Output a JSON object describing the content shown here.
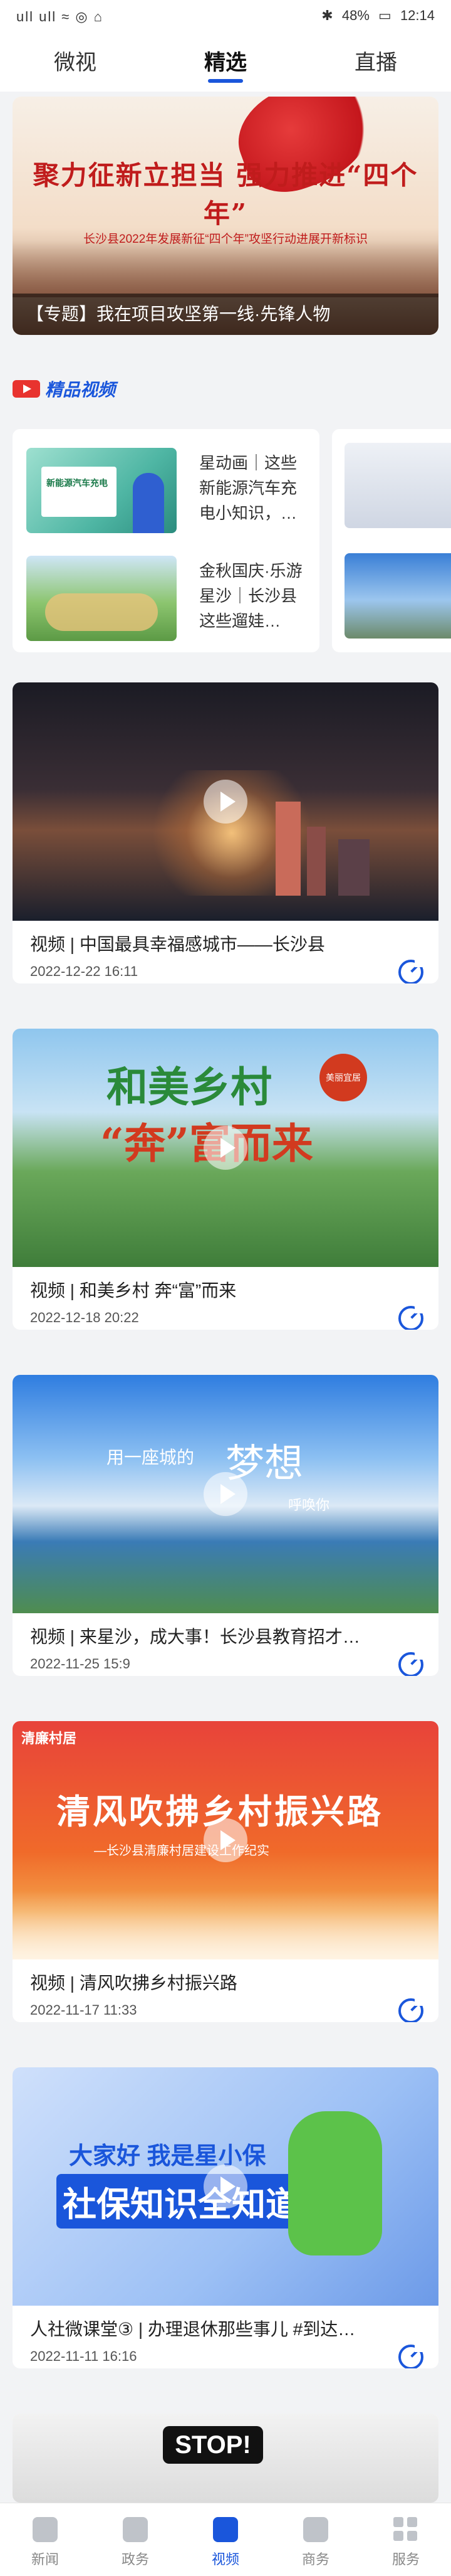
{
  "status_bar": {
    "left": "ull ull ≈ ◎ ⌂",
    "battery": "48%",
    "time": "12:14",
    "bluetooth": "✱"
  },
  "tabs": [
    {
      "label": "微视",
      "active": false
    },
    {
      "label": "精选",
      "active": true
    },
    {
      "label": "直播",
      "active": false
    }
  ],
  "banner": {
    "headline": "聚力征新立担当 强力推进“四个年”",
    "subline": "长沙县2022年发展新征“四个年”攻坚行动进展开新标识",
    "caption": "【专题】我在项目攻坚第一线·先锋人物"
  },
  "section": {
    "title": "精品视频"
  },
  "carousel": {
    "items": [
      {
        "title": "星动画｜这些新能源汽车充电小知识，…",
        "thumb_text": "新能源汽车充电"
      },
      {
        "title": "金秋国庆·乐游星沙｜长沙县这些遛娃…"
      }
    ]
  },
  "videos": [
    {
      "title": "视频 | 中国最具幸福感城市——长沙县",
      "date": "2022-12-22 16:11"
    },
    {
      "title": "视频 | 和美乡村 奔“富”而来",
      "date": "2022-12-18 20:22",
      "overlay_1": "和美乡村",
      "overlay_2": "“奔”富而来",
      "seal": "美丽宜居"
    },
    {
      "title": "视频 | 来星沙，成大事！长沙县教育招才…",
      "date": "2022-11-25 15:9",
      "overlay_1": "用一座城的",
      "overlay_2": "梦想",
      "overlay_3": "呼唤你"
    },
    {
      "title": "视频 | 清风吹拂乡村振兴路",
      "date": "2022-11-17 11:33",
      "logo": "清廉村居",
      "overlay_1": "清风吹拂乡村振兴路",
      "overlay_2": "—长沙县清廉村居建设工作纪实"
    },
    {
      "title": "人社微课堂③ | 办理退休那些事儿 #到达…",
      "date": "2022-11-11 16:16",
      "overlay_1": "大家好 我是星小保",
      "overlay_2": "社保知识全知道"
    },
    {
      "overlay_1": "STOP!"
    }
  ],
  "bottom_nav": [
    {
      "label": "新闻",
      "icon": "news-icon",
      "active": false
    },
    {
      "label": "政务",
      "icon": "government-icon",
      "active": false
    },
    {
      "label": "视频",
      "icon": "video-icon",
      "active": true
    },
    {
      "label": "商务",
      "icon": "business-icon",
      "active": false
    },
    {
      "label": "服务",
      "icon": "services-grid-icon",
      "active": false
    }
  ],
  "colors": {
    "accent": "#1a56db",
    "section_badge": "#e8332f"
  }
}
